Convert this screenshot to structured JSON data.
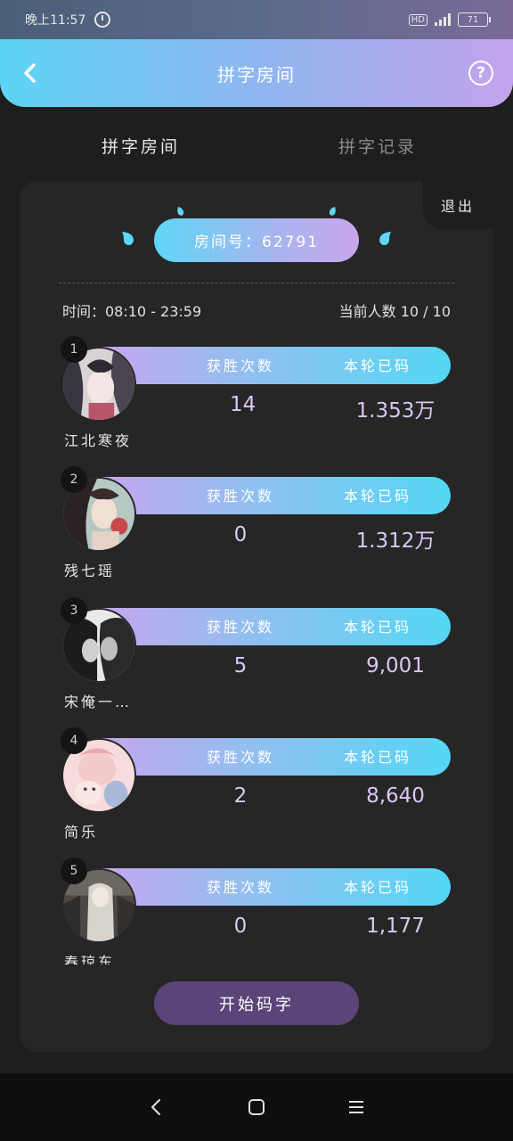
{
  "status_bar": {
    "time": "晚上11:57",
    "network_badge": "HD",
    "battery_level": "71",
    "icons": [
      "alarm-icon",
      "signal-icon",
      "battery-icon"
    ]
  },
  "header": {
    "title": "拼字房间",
    "back_icon": "chevron-left-icon",
    "help_icon": "question-circle-icon",
    "help_glyph": "?",
    "gradient_colors": [
      "#5cd4f5",
      "#c3a3ec"
    ]
  },
  "tabs": [
    {
      "label": "拼字房间",
      "active": true
    },
    {
      "label": "拼字记录",
      "active": false
    }
  ],
  "room": {
    "exit_label": "退出",
    "room_number_label": "房间号：62791",
    "time_label": "时间：08:10 - 23:59",
    "people_label": "当前人数 10 / 10"
  },
  "stat_labels": {
    "wins": "获胜次数",
    "words": "本轮已码"
  },
  "players": [
    {
      "rank": "1",
      "name": "江北寒夜",
      "wins": "14",
      "words": "1.353万"
    },
    {
      "rank": "2",
      "name": "残七瑶",
      "wins": "0",
      "words": "1.312万"
    },
    {
      "rank": "3",
      "name": "宋俺一…",
      "wins": "5",
      "words": "9,001"
    },
    {
      "rank": "4",
      "name": "简乐",
      "wins": "2",
      "words": "8,640"
    },
    {
      "rank": "5",
      "name": "春琼东…",
      "wins": "0",
      "words": "1,177"
    }
  ],
  "start_button": "开始码字",
  "nav": {
    "icons": [
      "back-triangle-icon",
      "home-square-icon",
      "menu-lines-icon"
    ]
  },
  "colors": {
    "background": "#1e1e1e",
    "card": "#262626",
    "accent_cyan": "#55d7f5",
    "accent_violet": "#c7a6ed",
    "start_button": "#5a4478",
    "value_text": "#d8c8f4"
  }
}
